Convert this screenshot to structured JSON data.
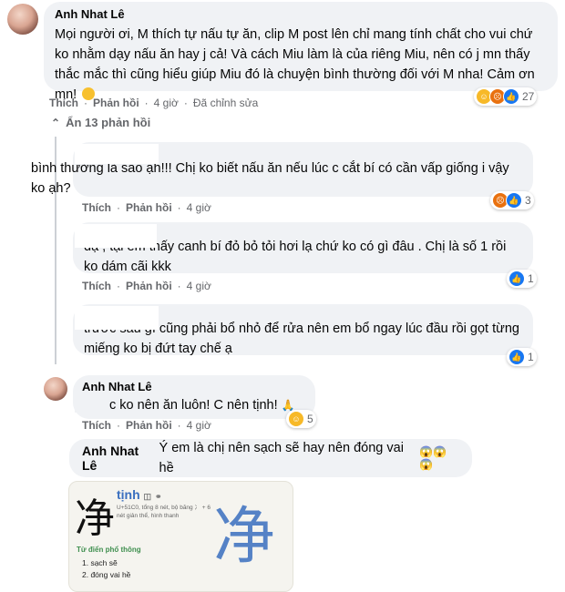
{
  "colors": {
    "bubble": "#f0f2f5",
    "meta": "#65676b",
    "like": "#1877f2",
    "haha": "#f7b928",
    "angry": "#e9710f"
  },
  "main_comment": {
    "author": "Anh Nhat Lê",
    "text": "Mọi người ơi, M thích tự nấu tự ăn, clip M post lên chỉ mang tính chất cho vui chứ ko nhằm dạy nấu ăn hay j cả! Và cách Miu làm là của riêng Miu, nên có j mn thấy thắc mắc thì cũng hiểu giúp Miu đó là chuyện bình thường đối với M nha! Cảm ơn mn!",
    "like": "Thích",
    "reply": "Phản hồi",
    "time": "4 giờ",
    "edited": "Đã chỉnh sửa",
    "reaction_icons": [
      "haha-icon",
      "angry-icon",
      "like-icon"
    ],
    "reaction_count": "27"
  },
  "hide_replies": "Ẩn 13 phản hồi",
  "replies": [
    {
      "author": "",
      "text": "bình thường là sao ạh!!! Chị ko biết nấu ăn nếu lúc c cắt bí có cần vấp giống i vậy ko ạh?",
      "like": "Thích",
      "reply": "Phản hồi",
      "time": "4 giờ",
      "reaction_icons": [
        "angry-icon",
        "like-icon"
      ],
      "reaction_count": "3"
    },
    {
      "author": "",
      "text": "dạ , tại em thấy canh bí đỏ bỏ tỏi hơi lạ chứ ko có gì đâu . Chị là số 1 rồi ko dám cãi kkk",
      "like": "Thích",
      "reply": "Phản hồi",
      "time": "4 giờ",
      "reaction_icons": [
        "like-icon"
      ],
      "reaction_count": "1"
    },
    {
      "author": "",
      "text": "trước sau gì cũng phải bổ nhỏ để rửa nên em bổ ngay lúc đầu rồi gọt từng miếng ko bị đứt tay chế ạ",
      "like": "",
      "reply": "",
      "time": "",
      "reaction_icons": [
        "like-icon"
      ],
      "reaction_count": "1"
    },
    {
      "author": "Anh Nhat Lê",
      "text": "c ko nên ăn luôn! C nên tịnh!",
      "like": "Thích",
      "reply": "Phản hồi",
      "time": "4 giờ",
      "reaction_icons": [
        "haha-icon"
      ],
      "reaction_count": "5"
    },
    {
      "author": "Anh Nhat Lê",
      "text": "Ý em là chị nên sạch sẽ hay nên đóng vai hề"
    }
  ],
  "dictionary": {
    "char": "净",
    "word": "tịnh",
    "meta": "U+51C0, tổng 8 nét, bộ băng 冫 + 6 nét giản thể, hình thanh",
    "section": "Từ điển phổ thông",
    "defs": [
      "1. sạch sẽ",
      "2. đóng vai hề"
    ]
  }
}
